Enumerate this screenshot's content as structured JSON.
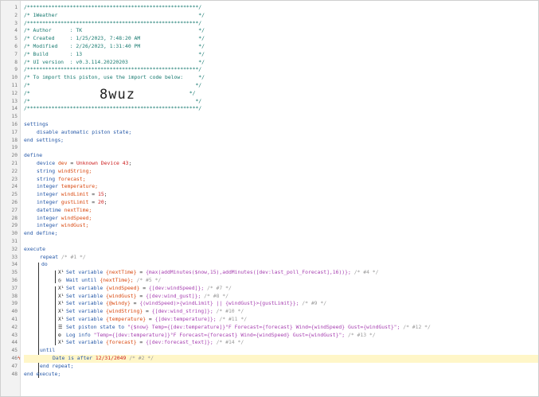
{
  "header": {
    "title_line": "/* 1Weather                                              */",
    "author_line": "/* Author      : TK                                      */",
    "created_line": "/* Created     : 1/25/2023, 7:48:20 AM                   */",
    "modified_line": "/* Modified    : 2/26/2023, 1:31:40 PM                   */",
    "build_line": "/* Build       : 13                                      */",
    "ui_version_line": "/* UI version  : v0.3.114.20220203                       */",
    "import_line": "/* To import this piston, use the import code below:     */",
    "import_code": "8wuz"
  },
  "settings": {
    "keyword": "settings",
    "item": "disable automatic piston state;",
    "end": "end settings;"
  },
  "define": {
    "keyword": "define",
    "end": "end define;",
    "device_type": "device",
    "device_name": "dev",
    "device_value": "Unknown Device 43",
    "vars": [
      {
        "type": "string",
        "name": "windString;"
      },
      {
        "type": "string",
        "name": "forecast;"
      },
      {
        "type": "integer",
        "name": "temperature;"
      },
      {
        "type": "integer",
        "name": "windLimit",
        "value": "15"
      },
      {
        "type": "integer",
        "name": "gustLimit",
        "value": "20"
      },
      {
        "type": "datetime",
        "name": "nextTime;"
      },
      {
        "type": "integer",
        "name": "windSpeed;"
      },
      {
        "type": "integer",
        "name": "windGust;"
      }
    ]
  },
  "execute": {
    "keyword": "execute",
    "end": "end execute;",
    "repeat": "repeat",
    "repeat_comment": "/* #1 */",
    "do": "do",
    "until": "until",
    "end_repeat": "end repeat;",
    "cond_subject": "Date",
    "cond_op": "is after",
    "cond_value": "12/31/2049",
    "cond_comment": "/* #2 */",
    "stmts": [
      {
        "icon": "X¹",
        "set": "Set variable",
        "var": "{nextTime}",
        "eq": "=",
        "expr": "{max(addMinutes($now,15),addMinutes([dev:last_poll_Forecast],16))};",
        "comment": "/* #4 */"
      },
      {
        "icon": "◷",
        "set": "Wait until",
        "var": "{nextTime};",
        "eq": "",
        "expr": "",
        "comment": "/* #5 */"
      },
      {
        "icon": "X¹",
        "set": "Set variable",
        "var": "{windSpeed}",
        "eq": "=",
        "expr": "{[dev:windSpeed]};",
        "comment": "/* #7 */"
      },
      {
        "icon": "X¹",
        "set": "Set variable",
        "var": "{windGust}",
        "eq": "=",
        "expr": "{[dev:wind_gust]};",
        "comment": "/* #8 */"
      },
      {
        "icon": "X¹",
        "set": "Set variable",
        "var": "{@windy}",
        "eq": "=",
        "expr": "{(windSpeed)>{windLimit} || {windGust}>{gustLimit}};",
        "comment": "/* #9 */"
      },
      {
        "icon": "X¹",
        "set": "Set variable",
        "var": "{windString}",
        "eq": "=",
        "expr": "{[dev:wind_string]};",
        "comment": "/* #10 */"
      },
      {
        "icon": "X¹",
        "set": "Set variable",
        "var": "{temperature}",
        "eq": "=",
        "expr": "{[dev:temperature]};",
        "comment": "/* #11 */"
      },
      {
        "icon": "☰",
        "set": "Set piston state to",
        "var": "\"{$now} Temp={[dev:temperature]}°F Forecast={forecast} Wind={windSpeed} Gust={windGust}\";",
        "eq": "",
        "expr": "",
        "comment": "/* #12 */"
      },
      {
        "icon": "⚙",
        "set": "Log info",
        "var": "\"Temp={[dev:temperature]}°F Forecast={forecast} Wind={windSpeed} Gust={windGust}\";",
        "eq": "",
        "expr": "",
        "comment": "/* #13 */"
      },
      {
        "icon": "X¹",
        "set": "Set variable",
        "var": "{forecast}",
        "eq": "=",
        "expr": "{[dev:forecast_text]};",
        "comment": "/* #14 */"
      }
    ]
  },
  "line_numbers": [
    "1",
    "2",
    "3",
    "4",
    "5",
    "6",
    "7",
    "8",
    "9",
    "10",
    "11",
    "12",
    "13",
    "14",
    "15",
    "16",
    "17",
    "18",
    "19",
    "20",
    "21",
    "22",
    "23",
    "24",
    "25",
    "26",
    "27",
    "28",
    "29",
    "30",
    "31",
    "32",
    "33",
    "34",
    "35",
    "36",
    "37",
    "38",
    "39",
    "40",
    "41",
    "42",
    "43",
    "44",
    "45",
    "46",
    "47",
    "48"
  ]
}
